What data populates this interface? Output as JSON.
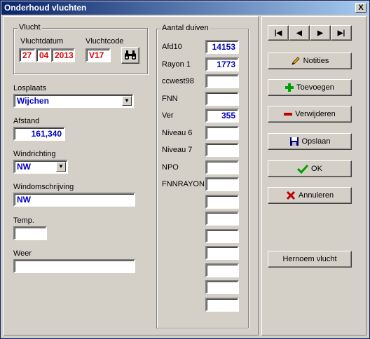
{
  "window": {
    "title": "Onderhoud vluchten",
    "close_label": "X"
  },
  "vlucht": {
    "group_label": "Vlucht",
    "datum_label": "Vluchtdatum",
    "code_label": "Vluchtcode",
    "day": "27",
    "month": "04",
    "year": "2013",
    "code": "V17"
  },
  "losplaats": {
    "label": "Losplaats",
    "value": "Wijchen"
  },
  "afstand": {
    "label": "Afstand",
    "value": "161,340"
  },
  "windrichting": {
    "label": "Windrichting",
    "value": "NW"
  },
  "windomschrijving": {
    "label": "Windomschrijving",
    "value": "NW"
  },
  "temp": {
    "label": "Temp.",
    "value": ""
  },
  "weer": {
    "label": "Weer",
    "value": ""
  },
  "aantal": {
    "group_label": "Aantal duiven",
    "rows": [
      {
        "label": "Afd10",
        "value": "14153"
      },
      {
        "label": "Rayon 1",
        "value": "1773"
      },
      {
        "label": "ccwest98",
        "value": ""
      },
      {
        "label": "FNN",
        "value": ""
      },
      {
        "label": "Ver",
        "value": "355"
      },
      {
        "label": "Niveau 6",
        "value": ""
      },
      {
        "label": "Niveau 7",
        "value": ""
      },
      {
        "label": "NPO",
        "value": ""
      },
      {
        "label": "FNNRAYON",
        "value": ""
      },
      {
        "label": "",
        "value": ""
      },
      {
        "label": "",
        "value": ""
      },
      {
        "label": "",
        "value": ""
      },
      {
        "label": "",
        "value": ""
      },
      {
        "label": "",
        "value": ""
      },
      {
        "label": "",
        "value": ""
      },
      {
        "label": "",
        "value": ""
      }
    ]
  },
  "nav": {
    "first": "|◀",
    "prev": "◀",
    "next": "▶",
    "last": "▶|"
  },
  "buttons": {
    "notities": "Notities",
    "toevoegen": "Toevoegen",
    "verwijderen": "Verwijderen",
    "opslaan": "Opslaan",
    "ok": "OK",
    "annuleren": "Annuleren",
    "hernoem": "Hernoem vlucht"
  },
  "colors": {
    "title_start": "#0a246a",
    "value_red": "#e00000",
    "value_blue": "#0000c0"
  }
}
